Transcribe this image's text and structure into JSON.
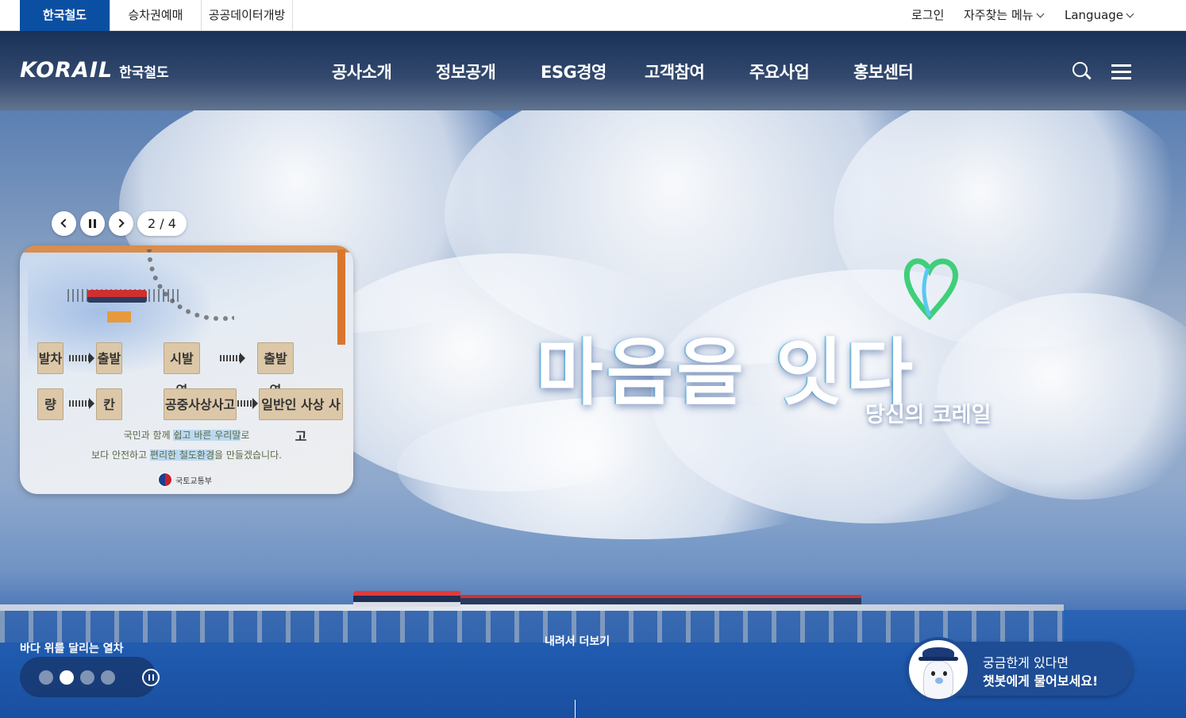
{
  "site_tabs": [
    {
      "label": "한국철도",
      "active": true
    },
    {
      "label": "승차권예매",
      "active": false
    },
    {
      "label": "공공데이터개방",
      "active": false
    }
  ],
  "util_links": {
    "login": "로그인",
    "favorites": "자주찾는 메뉴",
    "language": "Language"
  },
  "header": {
    "logo_main": "KORAIL",
    "logo_sub": "한국철도",
    "nav": [
      "공사소개",
      "정보공개",
      "ESG경영",
      "고객참여",
      "주요사업",
      "홍보센터"
    ],
    "search_icon": "search-icon",
    "menu_icon": "hamburger-menu-icon"
  },
  "hero": {
    "slogan": "마음을 잇다",
    "slogan_sub": "당신의 코레일",
    "caption": "바다 위를 달리는 열차",
    "scroll_more": "내려서 더보기",
    "total_slides": 4,
    "active_slide": 2
  },
  "popup": {
    "counter": "2 / 4",
    "tags": {
      "t1": "발차",
      "t2": "출발",
      "t3": "시발역",
      "t4": "출발역",
      "t5": "량",
      "t6": "칸",
      "t7": "공중사상사고",
      "t8": "일반인 사상 사고"
    },
    "line1_pre": "국민과 함께 ",
    "line1_hl": "쉽고 바른 우리말",
    "line1_post": "로",
    "line2_pre": "보다 안전하고 ",
    "line2_hl": "편리한 철도환경",
    "line2_post": "을 만들겠습니다.",
    "ministry": "국토교통부"
  },
  "chatbot": {
    "line1": "궁금한게 있다면",
    "line2": "챗봇에게 물어보세요!"
  },
  "colors": {
    "brand_blue": "#0b4fa3",
    "chatbot_bg": "#1e4d95",
    "popup_accent": "#d9762e"
  }
}
